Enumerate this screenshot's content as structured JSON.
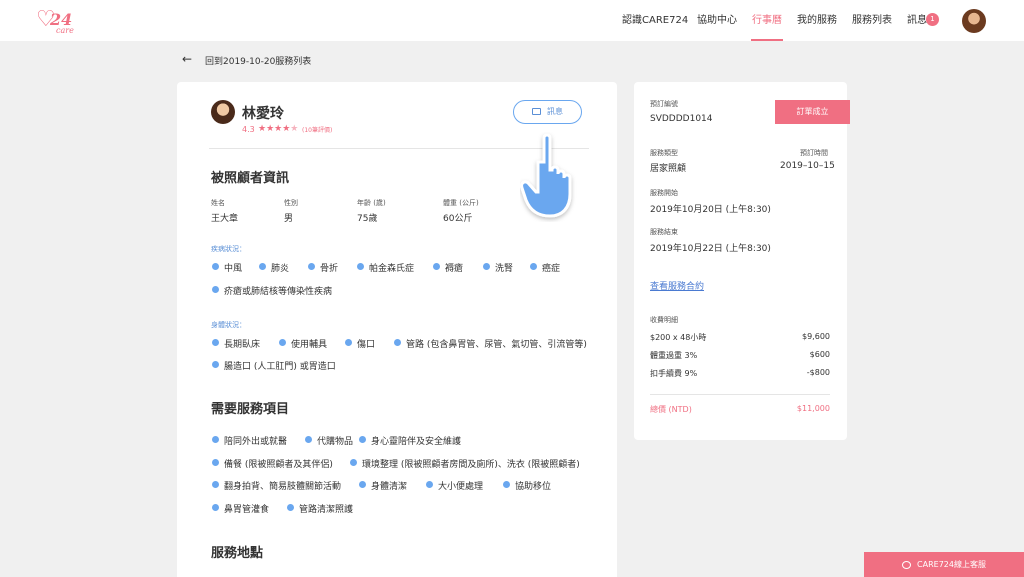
{
  "brand": {
    "logo_num": "24",
    "logo_sub": "care"
  },
  "nav": {
    "about": "認識CARE724",
    "help": "協助中心",
    "calendar": "行事曆",
    "my_services": "我的服務",
    "service_list": "服務列表",
    "messages": "訊息",
    "message_count": "1"
  },
  "back_link": "回到2019-10-20服務列表",
  "profile": {
    "name": "林愛玲",
    "rating": "4.3",
    "stars": "★★★★",
    "star_empty": "★",
    "reviews": "(10筆評價)",
    "message_button": "訊息"
  },
  "care_receiver": {
    "title": "被照顧者資訊",
    "name_label": "姓名",
    "name": "王大章",
    "gender_label": "性別",
    "gender": "男",
    "age_label": "年齡 (歲)",
    "age": "75歲",
    "weight_label": "體重 (公斤)",
    "weight": "60公斤",
    "disease_label": "疾病狀況：",
    "diseases": [
      "中風",
      "肺炎",
      "骨折",
      "帕金森氏症",
      "褥瘡",
      "洗腎",
      "癌症",
      "疥瘡或肺結核等傳染性疾病"
    ],
    "body_label": "身體狀況：",
    "body": [
      "長期臥床",
      "使用輔具",
      "傷口",
      "管路 (包含鼻胃管、尿管、氣切管、引流管等)",
      "腸造口 (人工肛門) 或胃造口"
    ]
  },
  "needed_services": {
    "title": "需要服務項目",
    "items": [
      "陪同外出或就醫",
      "代購物品",
      "身心靈陪伴及安全維護",
      "備餐 (限被照顧者及其伴侶)",
      "環境整理 (限被照顧者房間及廁所)、洗衣 (限被照顧者)",
      "翻身拍背、簡易肢體關節活動",
      "身體清潔",
      "大小便處理",
      "協助移位",
      "鼻胃管灌食",
      "管路清潔照護"
    ]
  },
  "location": {
    "title": "服務地點"
  },
  "order": {
    "order_no_label": "預訂編號",
    "order_no": "SVDDDD1014",
    "status": "訂單成立",
    "type_label": "服務類型",
    "type": "居家照顧",
    "date_label": "預訂時間",
    "date": "2019–10–15",
    "start_label": "服務開始",
    "start": "2019年10月20日 (上午8:30)",
    "end_label": "服務結束",
    "end": "2019年10月22日 (上午8:30)",
    "contract_link": "查看服務合約",
    "fee_label": "收費明細",
    "fees": [
      {
        "item": "$200 x 48小時",
        "amount": "$9,600"
      },
      {
        "item": "體重過重 3%",
        "amount": "$600"
      },
      {
        "item": "扣手續費 9%",
        "amount": "-$800"
      }
    ],
    "total_label": "總價 (NTD)",
    "total": "$11,000"
  },
  "support_button": "CARE724線上客服",
  "colors": {
    "accent": "#f06f82",
    "blue": "#6aa7ef",
    "link": "#4a7ad1"
  }
}
